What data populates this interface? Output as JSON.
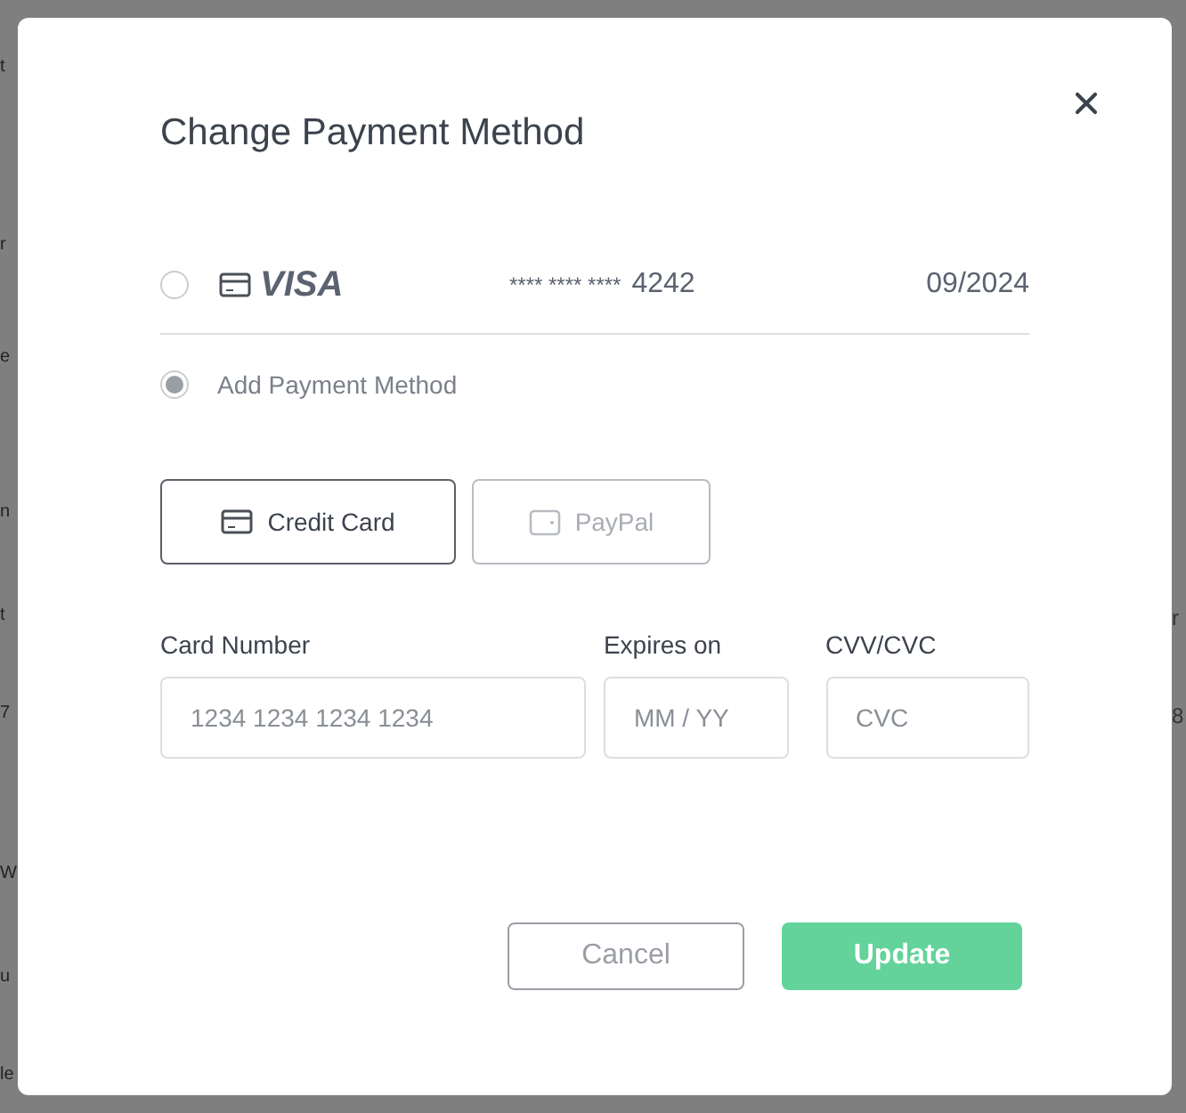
{
  "background": {
    "left_fragments": [
      "t",
      "r",
      "e",
      "n",
      "t",
      "7",
      "W",
      "u",
      "le"
    ],
    "right_fragments": [
      "r",
      "8"
    ]
  },
  "dialog": {
    "title": "Change Payment Method"
  },
  "saved_methods": [
    {
      "kind": "card",
      "selected": false,
      "brand": "VISA",
      "number_mask": "**** **** ****",
      "last4": "4242",
      "expiry": "09/2024"
    },
    {
      "kind": "add",
      "selected": true,
      "label": "Add Payment Method"
    }
  ],
  "method_tabs": [
    {
      "kind": "card",
      "label": "Credit Card",
      "selected": true
    },
    {
      "kind": "wallet",
      "label": "PayPal",
      "selected": false
    }
  ],
  "fields": [
    {
      "label": "Card Number",
      "placeholder": "1234 1234 1234 1234"
    },
    {
      "label": "Expires on",
      "placeholder": "MM / YY"
    },
    {
      "label": "CVV/CVC",
      "placeholder": "CVC"
    }
  ],
  "buttons": [
    {
      "kind": "secondary",
      "label": "Cancel"
    },
    {
      "kind": "primary",
      "label": "Update"
    }
  ]
}
